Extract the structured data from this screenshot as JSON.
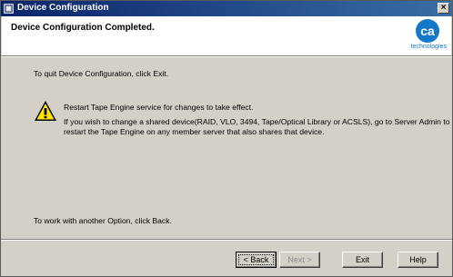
{
  "window": {
    "title": "Device Configuration"
  },
  "header": {
    "title": "Device Configuration Completed.",
    "logo_mark": "ca",
    "logo_text": "technologies"
  },
  "content": {
    "quit_text": "To quit Device Configuration, click Exit.",
    "restart_text": "Restart Tape Engine service for changes to take effect.",
    "shared_line1": "If you wish to change a shared device(RAID, VLO, 3494, Tape/Optical Library or ACSLS), go to Server Admin to",
    "shared_line2": "restart the Tape Engine on any member server that also shares that device.",
    "other_option_text": "To work with another Option, click Back.",
    "warning_icon": "warning-icon"
  },
  "buttons": {
    "back": "< Back",
    "next": "Next >",
    "exit": "Exit",
    "help": "Help",
    "close": "×"
  }
}
